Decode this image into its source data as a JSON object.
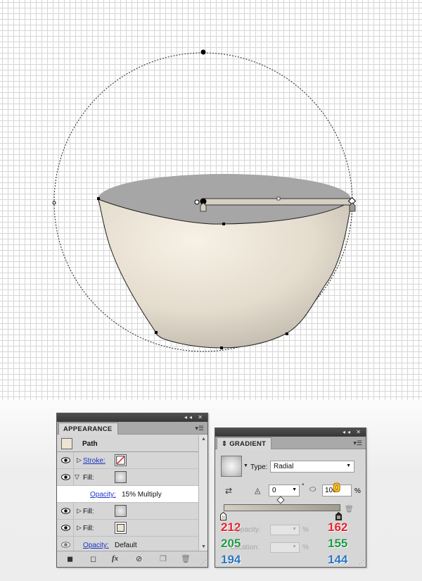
{
  "colors": {
    "bowl_light": "#f4ece0",
    "bowl_dark": "#a29b90",
    "inner_gray": "#a7a7a7",
    "canvas_grid": "#d6d6d6",
    "link_blue": "#1c34c8",
    "annotation_red": "#e3222c",
    "annotation_green": "#1c9a45",
    "annotation_blue": "#2a75c0",
    "annotation_yellow": "#f9c32c"
  },
  "appearance_panel": {
    "tab_label": "APPEARANCE",
    "object_label": "Path",
    "rows": [
      {
        "label": "Stroke:",
        "kind": "stroke-none",
        "expanded": false
      },
      {
        "label": "Fill:",
        "kind": "gradient",
        "expanded": true
      },
      {
        "label": "Opacity:",
        "value": "15% Multiply",
        "kind": "sub-opacity"
      },
      {
        "label": "Fill:",
        "kind": "gradient",
        "expanded": false
      },
      {
        "label": "Fill:",
        "kind": "cream",
        "expanded": false
      },
      {
        "label": "Opacity:",
        "value": "Default",
        "kind": "object-opacity"
      }
    ],
    "footer_icons": [
      "add-new-stroke-icon",
      "add-new-fill-icon",
      "fx-icon",
      "clear-appearance-icon",
      "duplicate-item-icon",
      "delete-item-icon"
    ],
    "fx_label": "fx"
  },
  "gradient_panel": {
    "tab_label": "GRADIENT",
    "type_label": "Type:",
    "type_value": "Radial",
    "angle_value": "0",
    "degree_symbol": "°",
    "aspect_value": "100",
    "percent_symbol": "%",
    "opacity_label": "Opacity:",
    "location_label": "Location:",
    "annotation_zero": "0",
    "left_stop": {
      "r": "212",
      "g": "205",
      "b": "194"
    },
    "right_stop": {
      "r": "162",
      "g": "155",
      "b": "144"
    }
  }
}
